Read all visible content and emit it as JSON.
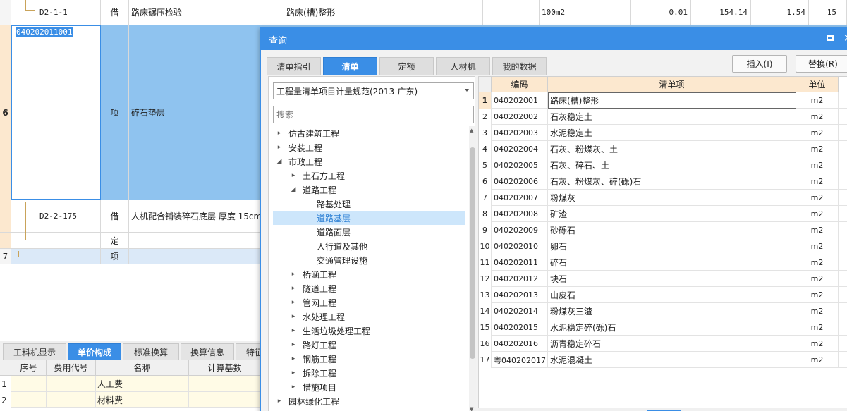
{
  "main_grid": {
    "row_top": {
      "code": "D2-1-1",
      "type": "借",
      "name": "路床碾压检验",
      "feature": "路床(槽)整形",
      "unit": "100m2",
      "qty": "0.01",
      "price": "154.14",
      "amount": "1.54",
      "extra": "15"
    },
    "row6": {
      "num": "6",
      "code": "040202011001",
      "type": "项",
      "name": "碎石垫层"
    },
    "row_sub1": {
      "code": "D2-2-175",
      "type": "借",
      "name": "人机配合铺装碎石底层 厚度 15cm"
    },
    "row_sub2": {
      "type": "定"
    },
    "row7": {
      "num": "7",
      "type": "项"
    }
  },
  "bottom_panel": {
    "tabs": [
      "工料机显示",
      "单价构成",
      "标准换算",
      "换算信息",
      "特征"
    ],
    "active_tab": 1,
    "columns": [
      "序号",
      "费用代号",
      "名称",
      "计算基数"
    ],
    "rows": [
      {
        "num": "1",
        "name": "人工费"
      },
      {
        "num": "2",
        "name": "材料费"
      }
    ]
  },
  "dialog": {
    "title": "查询",
    "close_glyph": "✕",
    "tabs": [
      "清单指引",
      "清单",
      "定额",
      "人材机",
      "我的数据"
    ],
    "active_tab": 1,
    "insert_label": "插入(I)",
    "replace_label": "替换(R)",
    "spec_select_value": "工程量清单项目计量规范(2013-广东)",
    "search_placeholder": "搜索",
    "tree": [
      {
        "label": "仿古建筑工程",
        "level": 0,
        "arrow": "▸"
      },
      {
        "label": "安装工程",
        "level": 0,
        "arrow": "▸"
      },
      {
        "label": "市政工程",
        "level": 0,
        "arrow": "◢"
      },
      {
        "label": "土石方工程",
        "level": 1,
        "arrow": "▸"
      },
      {
        "label": "道路工程",
        "level": 1,
        "arrow": "◢"
      },
      {
        "label": "路基处理",
        "level": 2,
        "arrow": ""
      },
      {
        "label": "道路基层",
        "level": 2,
        "arrow": "",
        "selected": true
      },
      {
        "label": "道路面层",
        "level": 2,
        "arrow": ""
      },
      {
        "label": "人行道及其他",
        "level": 2,
        "arrow": ""
      },
      {
        "label": "交通管理设施",
        "level": 2,
        "arrow": ""
      },
      {
        "label": "桥涵工程",
        "level": 1,
        "arrow": "▸"
      },
      {
        "label": "隧道工程",
        "level": 1,
        "arrow": "▸"
      },
      {
        "label": "管网工程",
        "level": 1,
        "arrow": "▸"
      },
      {
        "label": "水处理工程",
        "level": 1,
        "arrow": "▸"
      },
      {
        "label": "生活垃圾处理工程",
        "level": 1,
        "arrow": "▸"
      },
      {
        "label": "路灯工程",
        "level": 1,
        "arrow": "▸"
      },
      {
        "label": "钢筋工程",
        "level": 1,
        "arrow": "▸"
      },
      {
        "label": "拆除工程",
        "level": 1,
        "arrow": "▸"
      },
      {
        "label": "措施项目",
        "level": 1,
        "arrow": "▸"
      },
      {
        "label": "园林绿化工程",
        "level": 0,
        "arrow": "▸"
      }
    ],
    "table": {
      "columns": [
        "编码",
        "清单项",
        "单位"
      ],
      "rows": [
        {
          "num": "1",
          "code": "040202001",
          "name": "路床(槽)整形",
          "unit": "m2"
        },
        {
          "num": "2",
          "code": "040202002",
          "name": "石灰稳定土",
          "unit": "m2"
        },
        {
          "num": "3",
          "code": "040202003",
          "name": "水泥稳定土",
          "unit": "m2"
        },
        {
          "num": "4",
          "code": "040202004",
          "name": "石灰、粉煤灰、土",
          "unit": "m2"
        },
        {
          "num": "5",
          "code": "040202005",
          "name": "石灰、碎石、土",
          "unit": "m2"
        },
        {
          "num": "6",
          "code": "040202006",
          "name": "石灰、粉煤灰、碎(砾)石",
          "unit": "m2"
        },
        {
          "num": "7",
          "code": "040202007",
          "name": "粉煤灰",
          "unit": "m2"
        },
        {
          "num": "8",
          "code": "040202008",
          "name": "矿渣",
          "unit": "m2"
        },
        {
          "num": "9",
          "code": "040202009",
          "name": "砂砾石",
          "unit": "m2"
        },
        {
          "num": "10",
          "code": "040202010",
          "name": "卵石",
          "unit": "m2"
        },
        {
          "num": "11",
          "code": "040202011",
          "name": "碎石",
          "unit": "m2"
        },
        {
          "num": "12",
          "code": "040202012",
          "name": "块石",
          "unit": "m2"
        },
        {
          "num": "13",
          "code": "040202013",
          "name": "山皮石",
          "unit": "m2"
        },
        {
          "num": "14",
          "code": "040202014",
          "name": "粉煤灰三渣",
          "unit": "m2"
        },
        {
          "num": "15",
          "code": "040202015",
          "name": "水泥稳定碎(砾)石",
          "unit": "m2"
        },
        {
          "num": "16",
          "code": "040202016",
          "name": "沥青稳定碎石",
          "unit": "m2"
        },
        {
          "num": "17",
          "code": "粤040202017",
          "name": "水泥混凝土",
          "unit": "m2"
        }
      ]
    }
  },
  "colors": {
    "accent": "#3a8ee6",
    "selected_row_bg": "#8fc3ef",
    "header_bg": "#fce8cf",
    "row_highlight": "#dbe9f8"
  }
}
